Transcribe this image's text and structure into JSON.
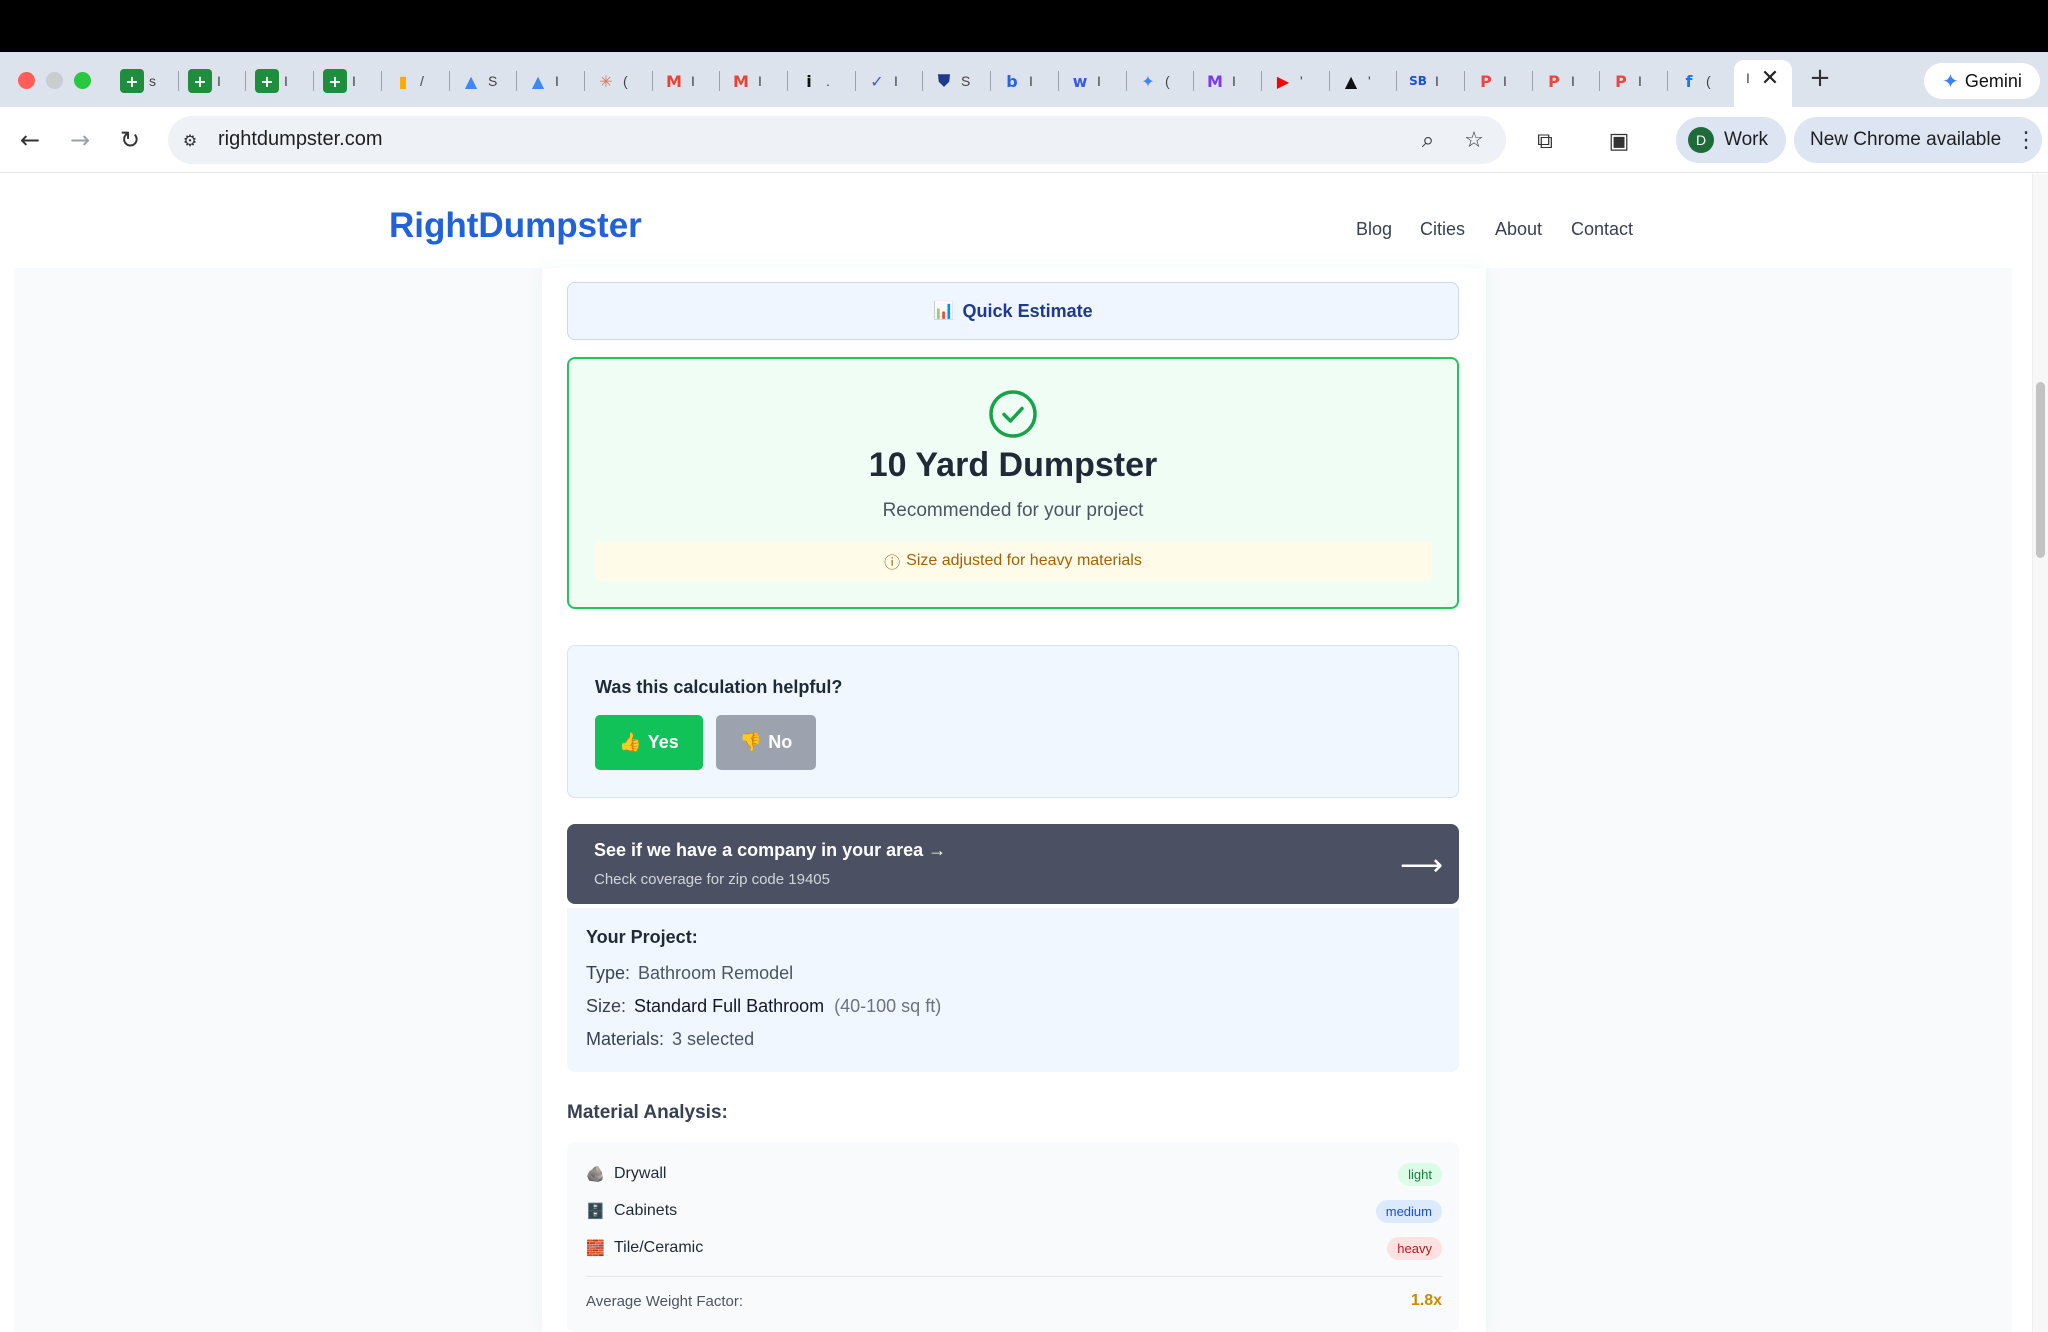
{
  "browser": {
    "tabs": [
      {
        "icon": "sheets-icon",
        "glyph": "+",
        "color": "#1e8e3e",
        "text": "s"
      },
      {
        "icon": "sheets-icon",
        "glyph": "+",
        "color": "#1e8e3e",
        "text": "I"
      },
      {
        "icon": "sheets-icon",
        "glyph": "+",
        "color": "#1e8e3e",
        "text": "I"
      },
      {
        "icon": "sheets-icon",
        "glyph": "+",
        "color": "#1e8e3e",
        "text": "I"
      },
      {
        "icon": "analytics-icon",
        "glyph": "▮",
        "color": "#f9ab00",
        "text": "/"
      },
      {
        "icon": "ads-icon",
        "glyph": "▲",
        "color": "#4285f4",
        "text": "S"
      },
      {
        "icon": "ads-icon",
        "glyph": "▲",
        "color": "#4285f4",
        "text": "I"
      },
      {
        "icon": "claude-icon",
        "glyph": "✳",
        "color": "#d97757",
        "text": "("
      },
      {
        "icon": "gmail-icon",
        "glyph": "M",
        "color": "#ea4335",
        "text": "I"
      },
      {
        "icon": "gmail-icon",
        "glyph": "M",
        "color": "#ea4335",
        "text": "I"
      },
      {
        "icon": "info-icon",
        "glyph": "i",
        "color": "#111111",
        "text": "."
      },
      {
        "icon": "todo-icon",
        "glyph": "✓",
        "color": "#3b5bdb",
        "text": "I"
      },
      {
        "icon": "shield-icon",
        "glyph": "⛊",
        "color": "#1e3a8a",
        "text": "S"
      },
      {
        "icon": "bing-icon",
        "glyph": "b",
        "color": "#2563eb",
        "text": "I"
      },
      {
        "icon": "wordtune-icon",
        "glyph": "w",
        "color": "#3b5bdb",
        "text": "I"
      },
      {
        "icon": "gemini-icon",
        "glyph": "✦",
        "color": "#4285f4",
        "text": "("
      },
      {
        "icon": "medium-icon",
        "glyph": "M",
        "color": "#7c3aed",
        "text": "I"
      },
      {
        "icon": "youtube-icon",
        "glyph": "▶",
        "color": "#ff0000",
        "text": "'"
      },
      {
        "icon": "vercel-icon",
        "glyph": "▲",
        "color": "#111111",
        "text": "'"
      },
      {
        "icon": "sb-icon",
        "glyph": "SB",
        "color": "#1d4ed8",
        "text": "I"
      },
      {
        "icon": "p-icon",
        "glyph": "P",
        "color": "#ef4444",
        "text": "I"
      },
      {
        "icon": "p-icon",
        "glyph": "P",
        "color": "#ef4444",
        "text": "I"
      },
      {
        "icon": "p-icon",
        "glyph": "P",
        "color": "#ef4444",
        "text": "I"
      },
      {
        "icon": "facebook-icon",
        "glyph": "f",
        "color": "#1877f2",
        "text": "("
      }
    ],
    "active_tab_text": "I",
    "gemini_label": "Gemini",
    "url": "rightdumpster.com",
    "profile_initial": "D",
    "profile_label": "Work",
    "update_label": "New Chrome available"
  },
  "site": {
    "logo": "RightDumpster",
    "nav": [
      "Blog",
      "Cities",
      "About",
      "Contact"
    ]
  },
  "estimate": {
    "quick_icon": "📊",
    "quick_label": "Quick Estimate"
  },
  "result": {
    "title": "10 Yard Dumpster",
    "subtitle": "Recommended for your project",
    "note": "Size adjusted for heavy materials",
    "accent": "#22c55e"
  },
  "feedback": {
    "question": "Was this calculation helpful?",
    "yes_icon": "👍",
    "yes_label": "Yes",
    "no_icon": "👎",
    "no_label": "No"
  },
  "coverage": {
    "title": "See if we have a company in your area →",
    "subtitle": "Check coverage for zip code 19405",
    "arrow": "⟶"
  },
  "project": {
    "heading": "Your Project:",
    "type_label": "Type:",
    "type_value": "Bathroom Remodel",
    "size_label": "Size:",
    "size_value": "Standard Full Bathroom",
    "size_range": "(40-100 sq ft)",
    "materials_label": "Materials:",
    "materials_value": "3 selected"
  },
  "analysis": {
    "heading": "Material Analysis:",
    "materials": [
      {
        "icon": "🪨",
        "name": "Drywall",
        "weight": "light"
      },
      {
        "icon": "🗄️",
        "name": "Cabinets",
        "weight": "medium"
      },
      {
        "icon": "🧱",
        "name": "Tile/Ceramic",
        "weight": "heavy"
      }
    ],
    "avg_label": "Average Weight Factor:",
    "avg_value": "1.8x"
  }
}
